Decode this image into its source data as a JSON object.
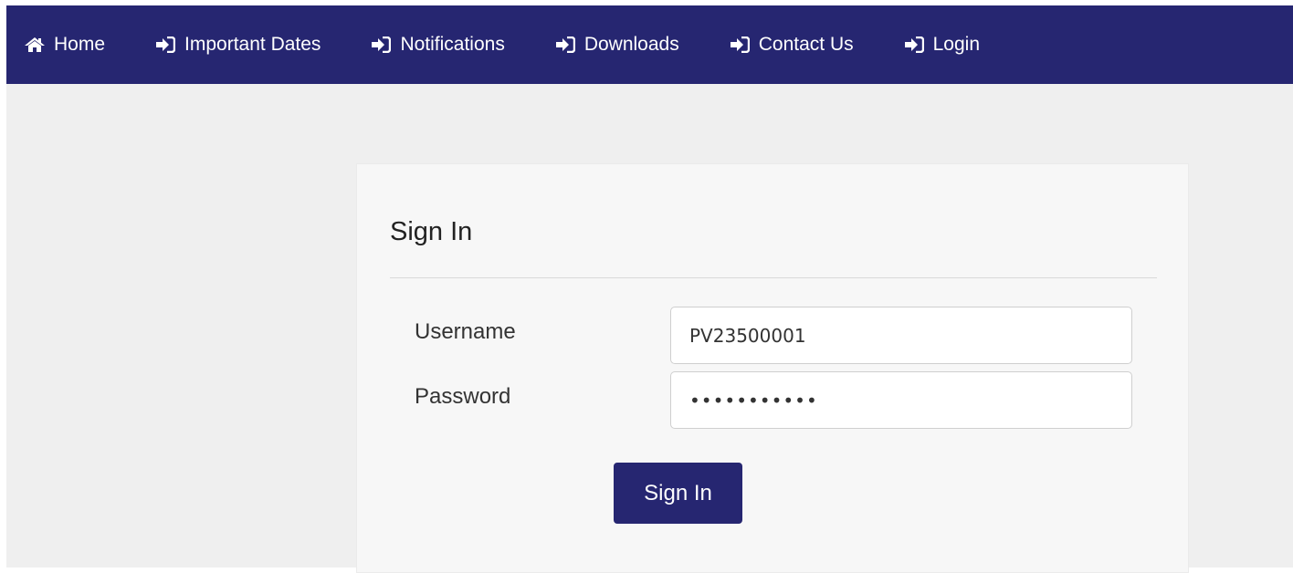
{
  "nav": {
    "items": [
      {
        "label": "Home",
        "icon": "home-icon"
      },
      {
        "label": "Important Dates",
        "icon": "sign-in-icon"
      },
      {
        "label": "Notifications",
        "icon": "sign-in-icon"
      },
      {
        "label": "Downloads",
        "icon": "sign-in-icon"
      },
      {
        "label": "Contact Us",
        "icon": "sign-in-icon"
      },
      {
        "label": "Login",
        "icon": "sign-in-icon"
      }
    ]
  },
  "form": {
    "title": "Sign In",
    "username_label": "Username",
    "username_value": "PV23500001",
    "password_label": "Password",
    "password_value": "•••••••••••",
    "submit_label": "Sign In"
  },
  "colors": {
    "brand": "#262671",
    "page_background": "#efefef",
    "card_background": "#f7f7f7"
  }
}
